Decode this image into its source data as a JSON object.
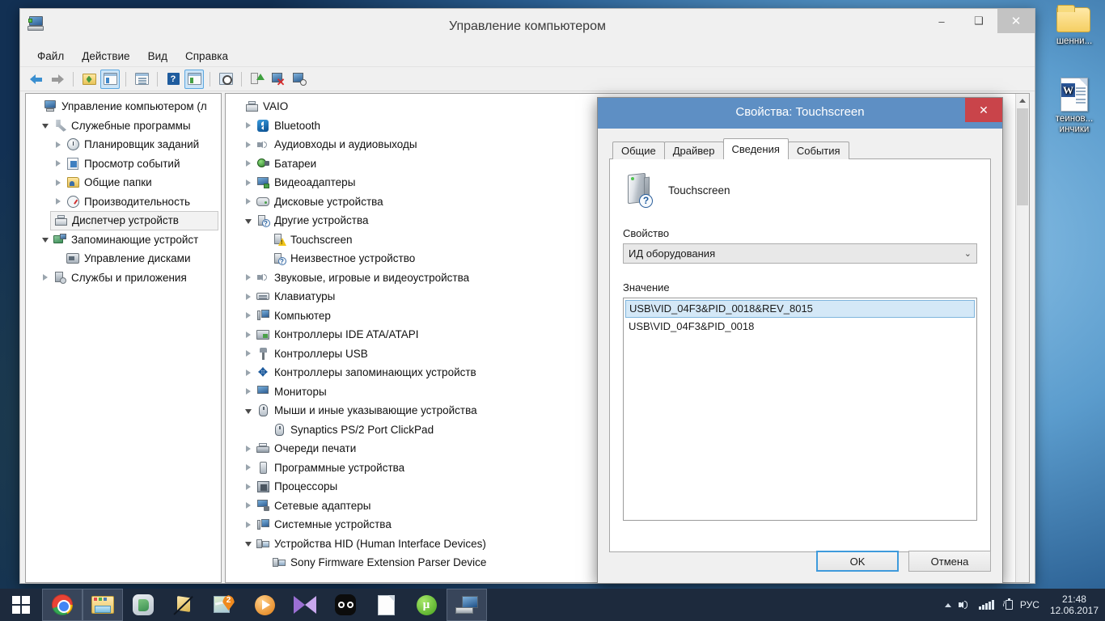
{
  "desktop": {
    "icons": [
      {
        "name": "folder-icon",
        "label": "шенни..."
      },
      {
        "name": "word-document-icon",
        "label": "теинов...\nинчики"
      }
    ]
  },
  "window": {
    "title": "Управление компьютером",
    "app_icon": "computer-management-icon",
    "controls": {
      "minimize": "–",
      "maximize": "❑",
      "close": "✕"
    },
    "menu": [
      "Файл",
      "Действие",
      "Вид",
      "Справка"
    ],
    "toolbar": [
      {
        "name": "back-button",
        "icon": "back-arrow-icon"
      },
      {
        "name": "forward-button",
        "icon": "forward-arrow-icon"
      },
      {
        "name": "up-folder-button",
        "icon": "folder-up-icon"
      },
      {
        "name": "show-console-tree-button",
        "icon": "console-tree-icon",
        "pressed": true
      },
      {
        "name": "properties-button",
        "icon": "properties-panel-icon"
      },
      {
        "name": "help-button",
        "icon": "help-icon"
      },
      {
        "name": "show-action-pane-button",
        "icon": "action-pane-icon",
        "pressed": true
      },
      {
        "name": "scan-hardware-button",
        "icon": "scan-magnifier-icon"
      },
      {
        "name": "update-driver-button",
        "icon": "update-driver-icon"
      },
      {
        "name": "disable-device-button",
        "icon": "disable-device-icon"
      },
      {
        "name": "add-device-button",
        "icon": "add-device-icon"
      }
    ]
  },
  "left_tree": {
    "items": [
      {
        "label": "Управление компьютером (л",
        "depth": 0,
        "icon": "computer-management-icon",
        "expander": "none"
      },
      {
        "label": "Служебные программы",
        "depth": 1,
        "icon": "tools-icon",
        "expander": "open"
      },
      {
        "label": "Планировщик заданий",
        "depth": 2,
        "icon": "task-scheduler-clock-icon",
        "expander": "closed"
      },
      {
        "label": "Просмотр событий",
        "depth": 2,
        "icon": "event-viewer-icon",
        "expander": "closed"
      },
      {
        "label": "Общие папки",
        "depth": 2,
        "icon": "shared-folders-icon",
        "expander": "closed"
      },
      {
        "label": "Производительность",
        "depth": 2,
        "icon": "performance-gauge-icon",
        "expander": "closed"
      },
      {
        "label": "Диспетчер устройств",
        "depth": 2,
        "icon": "device-manager-icon",
        "expander": "none",
        "selected": true
      },
      {
        "label": "Запоминающие устройст",
        "depth": 1,
        "icon": "storage-icon",
        "expander": "open"
      },
      {
        "label": "Управление дисками",
        "depth": 2,
        "icon": "disk-management-icon",
        "expander": "none"
      },
      {
        "label": "Службы и приложения",
        "depth": 1,
        "icon": "services-icon",
        "expander": "closed"
      }
    ]
  },
  "device_tree": {
    "items": [
      {
        "label": "VAIO",
        "depth": 0,
        "icon": "computer-root-icon",
        "expander": "none"
      },
      {
        "label": "Bluetooth",
        "depth": 1,
        "icon": "bluetooth-icon",
        "expander": "closed"
      },
      {
        "label": "Аудиовходы и аудиовыходы",
        "depth": 1,
        "icon": "audio-icon",
        "expander": "closed"
      },
      {
        "label": "Батареи",
        "depth": 1,
        "icon": "battery-icon",
        "expander": "closed"
      },
      {
        "label": "Видеоадаптеры",
        "depth": 1,
        "icon": "display-adapter-icon",
        "expander": "closed"
      },
      {
        "label": "Дисковые устройства",
        "depth": 1,
        "icon": "disk-drive-icon",
        "expander": "closed"
      },
      {
        "label": "Другие устройства",
        "depth": 1,
        "icon": "unknown-device-icon",
        "expander": "open"
      },
      {
        "label": "Touchscreen",
        "depth": 2,
        "icon": "warning-device-icon",
        "expander": "none"
      },
      {
        "label": "Неизвестное устройство",
        "depth": 2,
        "icon": "unknown-device-icon",
        "expander": "none"
      },
      {
        "label": "Звуковые, игровые и видеоустройства",
        "depth": 1,
        "icon": "audio-icon",
        "expander": "closed"
      },
      {
        "label": "Клавиатуры",
        "depth": 1,
        "icon": "keyboard-icon",
        "expander": "closed"
      },
      {
        "label": "Компьютер",
        "depth": 1,
        "icon": "computer-icon",
        "expander": "closed"
      },
      {
        "label": "Контроллеры IDE ATA/ATAPI",
        "depth": 1,
        "icon": "ide-controller-icon",
        "expander": "closed"
      },
      {
        "label": "Контроллеры USB",
        "depth": 1,
        "icon": "usb-icon",
        "expander": "closed"
      },
      {
        "label": "Контроллеры запоминающих устройств",
        "depth": 1,
        "icon": "storage-controller-icon",
        "expander": "closed"
      },
      {
        "label": "Мониторы",
        "depth": 1,
        "icon": "monitor-icon",
        "expander": "closed"
      },
      {
        "label": "Мыши и иные указывающие устройства",
        "depth": 1,
        "icon": "mouse-icon",
        "expander": "open"
      },
      {
        "label": "Synaptics PS/2 Port ClickPad",
        "depth": 2,
        "icon": "mouse-icon",
        "expander": "none"
      },
      {
        "label": "Очереди печати",
        "depth": 1,
        "icon": "printer-icon",
        "expander": "closed"
      },
      {
        "label": "Программные устройства",
        "depth": 1,
        "icon": "software-device-icon",
        "expander": "closed"
      },
      {
        "label": "Процессоры",
        "depth": 1,
        "icon": "processor-icon",
        "expander": "closed"
      },
      {
        "label": "Сетевые адаптеры",
        "depth": 1,
        "icon": "network-adapter-icon",
        "expander": "closed"
      },
      {
        "label": "Системные устройства",
        "depth": 1,
        "icon": "system-device-icon",
        "expander": "closed"
      },
      {
        "label": "Устройства HID (Human Interface Devices)",
        "depth": 1,
        "icon": "hid-device-icon",
        "expander": "open"
      },
      {
        "label": "Sony Firmware Extension Parser Device",
        "depth": 2,
        "icon": "hid-device-icon",
        "expander": "none"
      }
    ]
  },
  "dialog": {
    "title": "Свойства: Touchscreen",
    "close_label": "✕",
    "tabs": [
      {
        "label": "Общие",
        "active": false
      },
      {
        "label": "Драйвер",
        "active": false
      },
      {
        "label": "Сведения",
        "active": true
      },
      {
        "label": "События",
        "active": false
      }
    ],
    "device_name": "Touchscreen",
    "device_icon": "unknown-device-large-icon",
    "property_label": "Свойство",
    "property_value": "ИД оборудования",
    "value_label": "Значение",
    "values": [
      {
        "text": "USB\\VID_04F3&PID_0018&REV_8015",
        "selected": true
      },
      {
        "text": "USB\\VID_04F3&PID_0018",
        "selected": false
      }
    ],
    "ok_label": "OK",
    "cancel_label": "Отмена"
  },
  "taskbar": {
    "start_label": "start-button",
    "items": [
      {
        "name": "taskbar-chrome",
        "icon": "chrome-icon",
        "active": true
      },
      {
        "name": "taskbar-explorer",
        "icon": "file-explorer-icon",
        "active": true
      },
      {
        "name": "taskbar-onenote",
        "icon": "onenote-icon",
        "active": false
      },
      {
        "name": "taskbar-paint",
        "icon": "paint-icon",
        "active": false
      },
      {
        "name": "taskbar-maps",
        "icon": "maps-icon",
        "active": false
      },
      {
        "name": "taskbar-media-player",
        "icon": "media-player-icon",
        "active": false
      },
      {
        "name": "taskbar-mpc",
        "icon": "mpc-icon",
        "active": false
      },
      {
        "name": "taskbar-punto",
        "icon": "punto-switcher-icon",
        "active": false
      },
      {
        "name": "taskbar-notepad",
        "icon": "notepad-icon",
        "active": false
      },
      {
        "name": "taskbar-utorrent",
        "icon": "utorrent-icon",
        "active": false
      },
      {
        "name": "taskbar-computer-management",
        "icon": "computer-management-icon",
        "active": true
      }
    ],
    "tray": {
      "show_hidden": "show-hidden-icons-icon",
      "volume": "volume-icon",
      "network": "network-signal-icon",
      "battery": "battery-charging-icon",
      "language": "РУС",
      "time": "21:48",
      "date": "12.06.2017"
    }
  }
}
